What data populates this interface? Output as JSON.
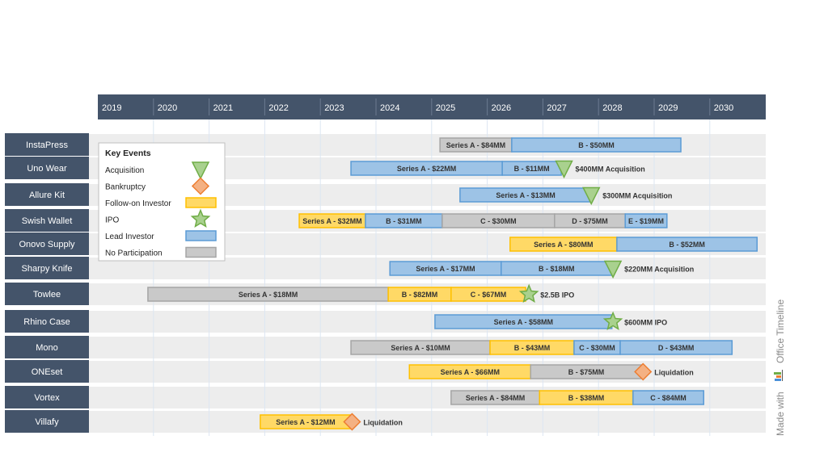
{
  "chart_data": {
    "type": "gantt-timeline",
    "title": "",
    "x_axis": {
      "start": 2019,
      "end": 2031,
      "ticks": [
        "2019",
        "2020",
        "2021",
        "2022",
        "2023",
        "2024",
        "2025",
        "2026",
        "2027",
        "2028",
        "2029",
        "2030"
      ]
    },
    "colors": {
      "header": "#44546a",
      "row_label_bg": "#44546a",
      "row_bg": "#ededed",
      "grid": "#dce6f2",
      "lead": "#9dc3e6",
      "lead_border": "#5b9bd5",
      "follow": "#ffd966",
      "follow_border": "#ffc000",
      "none": "#c9c9c9",
      "none_border": "#a5a5a5",
      "acquisition": "#a9d18e",
      "acquisition_border": "#70ad47",
      "bankruptcy": "#f4b183",
      "bankruptcy_border": "#ed7d31"
    },
    "legend": {
      "title": "Key Events",
      "placement": "top-left",
      "items": [
        {
          "label": "Acquisition",
          "symbol": "triangle-down"
        },
        {
          "label": "Bankruptcy",
          "symbol": "diamond"
        },
        {
          "label": "Follow-on Investor",
          "symbol": "bar-follow"
        },
        {
          "label": "IPO",
          "symbol": "star"
        },
        {
          "label": "Lead Investor",
          "symbol": "bar-lead"
        },
        {
          "label": "No Participation",
          "symbol": "bar-none"
        }
      ]
    },
    "rows": [
      {
        "company": "InstaPress",
        "rounds": [
          {
            "label": "Series A - $84MM",
            "type": "none",
            "start": 2025.15,
            "end": 2026.44
          },
          {
            "label": "B - $50MM",
            "type": "lead",
            "start": 2026.44,
            "end": 2029.48
          }
        ],
        "event": null
      },
      {
        "company": "Uno Wear",
        "rounds": [
          {
            "label": "Series A - $22MM",
            "type": "lead",
            "start": 2023.55,
            "end": 2026.27
          },
          {
            "label": "B - $11MM",
            "type": "lead",
            "start": 2026.27,
            "end": 2027.33
          }
        ],
        "event": {
          "type": "acquisition",
          "at": 2027.38,
          "label": "$400MM Acquisition"
        }
      },
      {
        "company": "Allure Kit",
        "rounds": [
          {
            "label": "Series A - $13MM",
            "type": "lead",
            "start": 2025.51,
            "end": 2027.87
          }
        ],
        "event": {
          "type": "acquisition",
          "at": 2027.87,
          "label": "$300MM Acquisition"
        }
      },
      {
        "company": "Swish Wallet",
        "rounds": [
          {
            "label": "Series A - $32MM",
            "type": "follow",
            "start": 2022.62,
            "end": 2023.81
          },
          {
            "label": "B - $31MM",
            "type": "lead",
            "start": 2023.81,
            "end": 2025.19
          },
          {
            "label": "C - $30MM",
            "type": "none",
            "start": 2025.19,
            "end": 2027.21
          },
          {
            "label": "D - $75MM",
            "type": "none",
            "start": 2027.21,
            "end": 2028.48
          },
          {
            "label": "E - $19MM",
            "type": "lead",
            "start": 2028.48,
            "end": 2029.23
          }
        ],
        "event": null
      },
      {
        "company": "Onovo Supply",
        "rounds": [
          {
            "label": "Series A - $80MM",
            "type": "follow",
            "start": 2026.41,
            "end": 2028.33
          },
          {
            "label": "B - $52MM",
            "type": "lead",
            "start": 2028.33,
            "end": 2030.85
          }
        ],
        "event": null
      },
      {
        "company": "Sharpy Knife",
        "rounds": [
          {
            "label": "Series A - $17MM",
            "type": "lead",
            "start": 2024.25,
            "end": 2026.25
          },
          {
            "label": "B - $18MM",
            "type": "lead",
            "start": 2026.25,
            "end": 2028.24
          }
        ],
        "event": {
          "type": "acquisition",
          "at": 2028.26,
          "label": "$220MM Acquisition"
        }
      },
      {
        "company": "Towlee",
        "rounds": [
          {
            "label": "Series A - $18MM",
            "type": "none",
            "start": 2019.9,
            "end": 2024.22
          },
          {
            "label": "B - $82MM",
            "type": "follow",
            "start": 2024.22,
            "end": 2025.35
          },
          {
            "label": "C - $67MM",
            "type": "follow",
            "start": 2025.35,
            "end": 2026.69
          }
        ],
        "event": {
          "type": "ipo",
          "at": 2026.75,
          "label": "$2.5B IPO"
        }
      },
      {
        "company": "Rhino Case",
        "rounds": [
          {
            "label": "Series A - $58MM",
            "type": "lead",
            "start": 2025.06,
            "end": 2028.24
          }
        ],
        "event": {
          "type": "ipo",
          "at": 2028.26,
          "label": "$600MM IPO"
        }
      },
      {
        "company": "Mono",
        "rounds": [
          {
            "label": "Series A - $10MM",
            "type": "none",
            "start": 2023.55,
            "end": 2026.05
          },
          {
            "label": "B - $43MM",
            "type": "follow",
            "start": 2026.05,
            "end": 2027.56
          },
          {
            "label": "C - $30MM",
            "type": "lead",
            "start": 2027.56,
            "end": 2028.39
          },
          {
            "label": "D - $43MM",
            "type": "lead",
            "start": 2028.39,
            "end": 2030.4
          }
        ],
        "event": null
      },
      {
        "company": "ONEset",
        "rounds": [
          {
            "label": "Series A - $66MM",
            "type": "follow",
            "start": 2024.6,
            "end": 2026.78
          },
          {
            "label": "B - $75MM",
            "type": "none",
            "start": 2026.78,
            "end": 2028.78
          }
        ],
        "event": {
          "type": "bankruptcy",
          "at": 2028.8,
          "label": "Liquidation"
        }
      },
      {
        "company": "Vortex",
        "rounds": [
          {
            "label": "Series A - $84MM",
            "type": "none",
            "start": 2025.35,
            "end": 2026.94
          },
          {
            "label": "B - $38MM",
            "type": "follow",
            "start": 2026.94,
            "end": 2028.62
          },
          {
            "label": "C - $84MM",
            "type": "lead",
            "start": 2028.62,
            "end": 2029.89
          }
        ],
        "event": null
      },
      {
        "company": "Villafy",
        "rounds": [
          {
            "label": "Series A - $12MM",
            "type": "follow",
            "start": 2021.92,
            "end": 2023.55
          }
        ],
        "event": {
          "type": "bankruptcy",
          "at": 2023.57,
          "label": "Liquidation"
        }
      }
    ]
  },
  "watermark": {
    "prefix": "Made with",
    "brand": "Office Timeline"
  }
}
